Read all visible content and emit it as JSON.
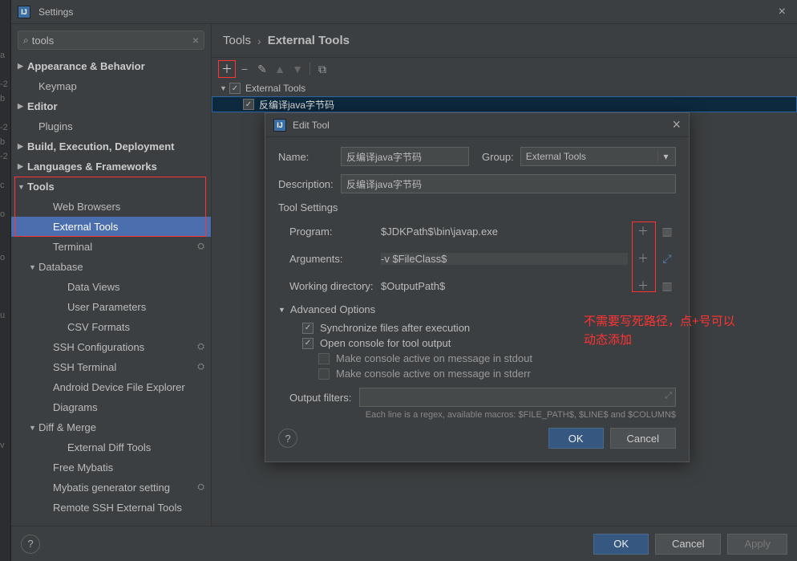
{
  "window": {
    "title": "Settings"
  },
  "search": {
    "value": "tools"
  },
  "sidebar": {
    "items": [
      {
        "label": "Appearance & Behavior",
        "arrow": "▶",
        "bold": true,
        "lvl": 0
      },
      {
        "label": "Keymap",
        "lvl": 1
      },
      {
        "label": "Editor",
        "arrow": "▶",
        "bold": true,
        "lvl": 0
      },
      {
        "label": "Plugins",
        "lvl": 1
      },
      {
        "label": "Build, Execution, Deployment",
        "arrow": "▶",
        "bold": true,
        "lvl": 0
      },
      {
        "label": "Languages & Frameworks",
        "arrow": "▶",
        "bold": true,
        "lvl": 0
      },
      {
        "label": "Tools",
        "arrow": "▼",
        "bold": true,
        "lvl": 0,
        "boxStart": true
      },
      {
        "label": "Web Browsers",
        "lvl": 2
      },
      {
        "label": "External Tools",
        "lvl": 2,
        "selected": true,
        "boxEnd": true
      },
      {
        "label": "Terminal",
        "lvl": 2,
        "gear": true
      },
      {
        "label": "Database",
        "arrow": "▼",
        "lvl": 1
      },
      {
        "label": "Data Views",
        "lvl": 3
      },
      {
        "label": "User Parameters",
        "lvl": 3
      },
      {
        "label": "CSV Formats",
        "lvl": 3
      },
      {
        "label": "SSH Configurations",
        "lvl": 2,
        "gear": true
      },
      {
        "label": "SSH Terminal",
        "lvl": 2,
        "gear": true
      },
      {
        "label": "Android Device File Explorer",
        "lvl": 2
      },
      {
        "label": "Diagrams",
        "lvl": 2
      },
      {
        "label": "Diff & Merge",
        "arrow": "▼",
        "lvl": 1
      },
      {
        "label": "External Diff Tools",
        "lvl": 3
      },
      {
        "label": "Free Mybatis",
        "lvl": 2
      },
      {
        "label": "Mybatis generator setting",
        "lvl": 2,
        "gear": true
      },
      {
        "label": "Remote SSH External Tools",
        "lvl": 2
      }
    ]
  },
  "breadcrumb": {
    "root": "Tools",
    "leaf": "External Tools"
  },
  "list": {
    "group": "External Tools",
    "item": "反编译java字节码"
  },
  "dialog": {
    "title": "Edit Tool",
    "name_label": "Name:",
    "name_value": "反编译java字节码",
    "group_label": "Group:",
    "group_value": "External Tools",
    "desc_label": "Description:",
    "desc_value": "反编译java字节码",
    "section": "Tool Settings",
    "program_label": "Program:",
    "program_value": "$JDKPath$\\bin\\javap.exe",
    "args_label": "Arguments:",
    "args_value": "-v $FileClass$",
    "wd_label": "Working directory:",
    "wd_value": "$OutputPath$",
    "adv": "Advanced Options",
    "sync": "Synchronize files after execution",
    "open_console": "Open console for tool output",
    "stdout": "Make console active on message in stdout",
    "stderr": "Make console active on message in stderr",
    "filters_label": "Output filters:",
    "hint": "Each line is a regex, available macros: $FILE_PATH$, $LINE$ and $COLUMN$",
    "ok": "OK",
    "cancel": "Cancel"
  },
  "annotation": {
    "text1": "不需要写死路径，点+号可以",
    "text2": "动态添加"
  },
  "bottom": {
    "ok": "OK",
    "cancel": "Cancel",
    "apply": "Apply"
  }
}
